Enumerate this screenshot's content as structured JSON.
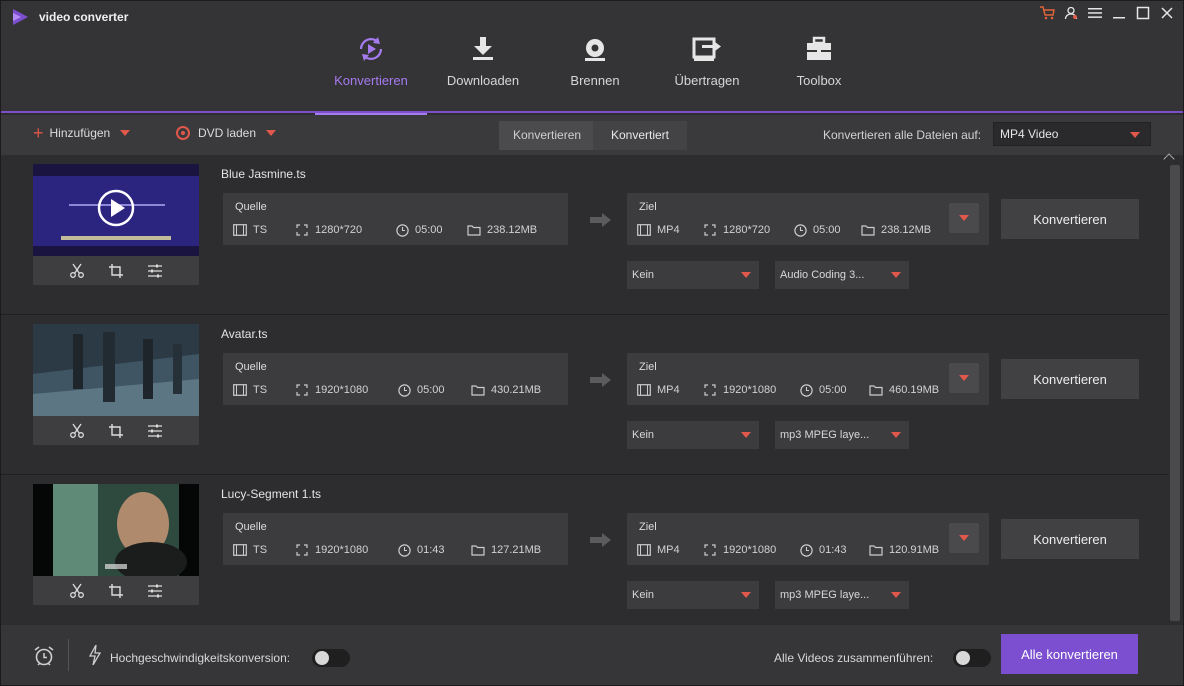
{
  "app": {
    "title": "video converter"
  },
  "nav": {
    "tabs": [
      {
        "label": "Konvertieren",
        "active": true
      },
      {
        "label": "Downloaden",
        "active": false
      },
      {
        "label": "Brennen",
        "active": false
      },
      {
        "label": "Übertragen",
        "active": false
      },
      {
        "label": "Toolbox",
        "active": false
      }
    ]
  },
  "toolbar": {
    "add_label": "Hinzufügen",
    "dvd_label": "DVD laden",
    "seg_converting": "Konvertieren",
    "seg_converted": "Konvertiert",
    "convert_all_to_label": "Konvertieren alle Dateien auf:",
    "format_value": "MP4 Video"
  },
  "files": [
    {
      "name": "Blue Jasmine.ts",
      "source": {
        "label": "Quelle",
        "format": "TS",
        "resolution": "1280*720",
        "duration": "05:00",
        "size": "238.12MB"
      },
      "target": {
        "label": "Ziel",
        "format": "MP4",
        "resolution": "1280*720",
        "duration": "05:00",
        "size": "238.12MB"
      },
      "subtitle": "Kein",
      "audio": "Audio Coding 3...",
      "convert_label": "Konvertieren"
    },
    {
      "name": "Avatar.ts",
      "source": {
        "label": "Quelle",
        "format": "TS",
        "resolution": "1920*1080",
        "duration": "05:00",
        "size": "430.21MB"
      },
      "target": {
        "label": "Ziel",
        "format": "MP4",
        "resolution": "1920*1080",
        "duration": "05:00",
        "size": "460.19MB"
      },
      "subtitle": "Kein",
      "audio": "mp3 MPEG laye...",
      "convert_label": "Konvertieren"
    },
    {
      "name": "Lucy-Segment 1.ts",
      "source": {
        "label": "Quelle",
        "format": "TS",
        "resolution": "1920*1080",
        "duration": "01:43",
        "size": "127.21MB"
      },
      "target": {
        "label": "Ziel",
        "format": "MP4",
        "resolution": "1920*1080",
        "duration": "01:43",
        "size": "120.91MB"
      },
      "subtitle": "Kein",
      "audio": "mp3 MPEG laye...",
      "convert_label": "Konvertieren"
    }
  ],
  "bottom": {
    "high_speed_label": "Hochgeschwindigkeitskonversion:",
    "merge_label": "Alle Videos zusammenführen:",
    "convert_all_label": "Alle konvertieren"
  },
  "colors": {
    "accent": "#7b4fd0",
    "nav_active": "#a57bf0",
    "orange": "#e0584a"
  }
}
